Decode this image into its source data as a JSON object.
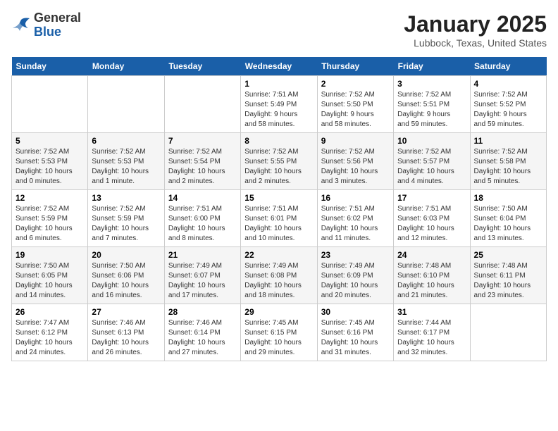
{
  "header": {
    "logo_general": "General",
    "logo_blue": "Blue",
    "month_title": "January 2025",
    "location": "Lubbock, Texas, United States"
  },
  "days_of_week": [
    "Sunday",
    "Monday",
    "Tuesday",
    "Wednesday",
    "Thursday",
    "Friday",
    "Saturday"
  ],
  "weeks": [
    [
      {
        "day": "",
        "info": ""
      },
      {
        "day": "",
        "info": ""
      },
      {
        "day": "",
        "info": ""
      },
      {
        "day": "1",
        "info": "Sunrise: 7:51 AM\nSunset: 5:49 PM\nDaylight: 9 hours\nand 58 minutes."
      },
      {
        "day": "2",
        "info": "Sunrise: 7:52 AM\nSunset: 5:50 PM\nDaylight: 9 hours\nand 58 minutes."
      },
      {
        "day": "3",
        "info": "Sunrise: 7:52 AM\nSunset: 5:51 PM\nDaylight: 9 hours\nand 59 minutes."
      },
      {
        "day": "4",
        "info": "Sunrise: 7:52 AM\nSunset: 5:52 PM\nDaylight: 9 hours\nand 59 minutes."
      }
    ],
    [
      {
        "day": "5",
        "info": "Sunrise: 7:52 AM\nSunset: 5:53 PM\nDaylight: 10 hours\nand 0 minutes."
      },
      {
        "day": "6",
        "info": "Sunrise: 7:52 AM\nSunset: 5:53 PM\nDaylight: 10 hours\nand 1 minute."
      },
      {
        "day": "7",
        "info": "Sunrise: 7:52 AM\nSunset: 5:54 PM\nDaylight: 10 hours\nand 2 minutes."
      },
      {
        "day": "8",
        "info": "Sunrise: 7:52 AM\nSunset: 5:55 PM\nDaylight: 10 hours\nand 2 minutes."
      },
      {
        "day": "9",
        "info": "Sunrise: 7:52 AM\nSunset: 5:56 PM\nDaylight: 10 hours\nand 3 minutes."
      },
      {
        "day": "10",
        "info": "Sunrise: 7:52 AM\nSunset: 5:57 PM\nDaylight: 10 hours\nand 4 minutes."
      },
      {
        "day": "11",
        "info": "Sunrise: 7:52 AM\nSunset: 5:58 PM\nDaylight: 10 hours\nand 5 minutes."
      }
    ],
    [
      {
        "day": "12",
        "info": "Sunrise: 7:52 AM\nSunset: 5:59 PM\nDaylight: 10 hours\nand 6 minutes."
      },
      {
        "day": "13",
        "info": "Sunrise: 7:52 AM\nSunset: 5:59 PM\nDaylight: 10 hours\nand 7 minutes."
      },
      {
        "day": "14",
        "info": "Sunrise: 7:51 AM\nSunset: 6:00 PM\nDaylight: 10 hours\nand 8 minutes."
      },
      {
        "day": "15",
        "info": "Sunrise: 7:51 AM\nSunset: 6:01 PM\nDaylight: 10 hours\nand 10 minutes."
      },
      {
        "day": "16",
        "info": "Sunrise: 7:51 AM\nSunset: 6:02 PM\nDaylight: 10 hours\nand 11 minutes."
      },
      {
        "day": "17",
        "info": "Sunrise: 7:51 AM\nSunset: 6:03 PM\nDaylight: 10 hours\nand 12 minutes."
      },
      {
        "day": "18",
        "info": "Sunrise: 7:50 AM\nSunset: 6:04 PM\nDaylight: 10 hours\nand 13 minutes."
      }
    ],
    [
      {
        "day": "19",
        "info": "Sunrise: 7:50 AM\nSunset: 6:05 PM\nDaylight: 10 hours\nand 14 minutes."
      },
      {
        "day": "20",
        "info": "Sunrise: 7:50 AM\nSunset: 6:06 PM\nDaylight: 10 hours\nand 16 minutes."
      },
      {
        "day": "21",
        "info": "Sunrise: 7:49 AM\nSunset: 6:07 PM\nDaylight: 10 hours\nand 17 minutes."
      },
      {
        "day": "22",
        "info": "Sunrise: 7:49 AM\nSunset: 6:08 PM\nDaylight: 10 hours\nand 18 minutes."
      },
      {
        "day": "23",
        "info": "Sunrise: 7:49 AM\nSunset: 6:09 PM\nDaylight: 10 hours\nand 20 minutes."
      },
      {
        "day": "24",
        "info": "Sunrise: 7:48 AM\nSunset: 6:10 PM\nDaylight: 10 hours\nand 21 minutes."
      },
      {
        "day": "25",
        "info": "Sunrise: 7:48 AM\nSunset: 6:11 PM\nDaylight: 10 hours\nand 23 minutes."
      }
    ],
    [
      {
        "day": "26",
        "info": "Sunrise: 7:47 AM\nSunset: 6:12 PM\nDaylight: 10 hours\nand 24 minutes."
      },
      {
        "day": "27",
        "info": "Sunrise: 7:46 AM\nSunset: 6:13 PM\nDaylight: 10 hours\nand 26 minutes."
      },
      {
        "day": "28",
        "info": "Sunrise: 7:46 AM\nSunset: 6:14 PM\nDaylight: 10 hours\nand 27 minutes."
      },
      {
        "day": "29",
        "info": "Sunrise: 7:45 AM\nSunset: 6:15 PM\nDaylight: 10 hours\nand 29 minutes."
      },
      {
        "day": "30",
        "info": "Sunrise: 7:45 AM\nSunset: 6:16 PM\nDaylight: 10 hours\nand 31 minutes."
      },
      {
        "day": "31",
        "info": "Sunrise: 7:44 AM\nSunset: 6:17 PM\nDaylight: 10 hours\nand 32 minutes."
      },
      {
        "day": "",
        "info": ""
      }
    ]
  ]
}
